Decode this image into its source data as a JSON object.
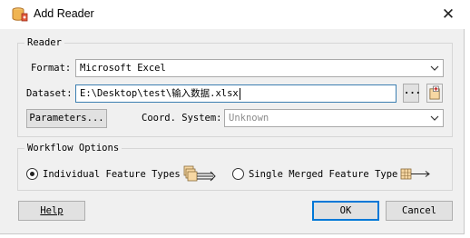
{
  "window": {
    "title": "Add Reader",
    "close_icon": "close-icon"
  },
  "reader": {
    "group_label": "Reader",
    "format_label": "Format:",
    "format_value": "Microsoft Excel",
    "dataset_label": "Dataset:",
    "dataset_value": "E:\\Desktop\\test\\输入数据.xlsx",
    "browse_label": "...",
    "parameters_label": "Parameters...",
    "coord_label": "Coord. System:",
    "coord_value": "Unknown"
  },
  "workflow": {
    "group_label": "Workflow Options",
    "option_individual": "Individual Feature Types",
    "option_single": "Single Merged Feature Type",
    "selected": "individual"
  },
  "buttons": {
    "help": "Help",
    "ok": "OK",
    "cancel": "Cancel"
  },
  "colors": {
    "focus_border": "#3c7fb1",
    "default_button_border": "#0078d7",
    "dialog_bg": "#f0f0f0"
  }
}
